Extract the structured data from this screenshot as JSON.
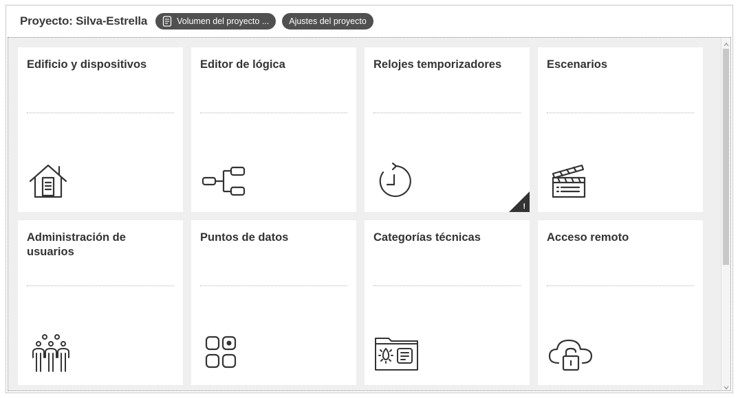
{
  "header": {
    "project_title": "Proyecto: Silva-Estrella",
    "volume_button": "Volumen del proyecto ...",
    "settings_button": "Ajustes del proyecto"
  },
  "tiles": [
    {
      "title": "Edificio y dispositivos",
      "icon": "house-icon"
    },
    {
      "title": "Editor de lógica",
      "icon": "logic-flow-icon"
    },
    {
      "title": "Relojes temporizadores",
      "icon": "timer-clock-icon",
      "badge": "!"
    },
    {
      "title": "Escenarios",
      "icon": "clapperboard-icon"
    },
    {
      "title": "Administración de usuarios",
      "icon": "users-group-icon"
    },
    {
      "title": "Puntos de datos",
      "icon": "datapoints-grid-icon"
    },
    {
      "title": "Categorías técnicas",
      "icon": "technical-folder-icon"
    },
    {
      "title": "Acceso remoto",
      "icon": "cloud-lock-icon"
    }
  ],
  "colors": {
    "pill": "#505050",
    "background": "#efefef",
    "tile": "#ffffff",
    "text": "#333333"
  }
}
